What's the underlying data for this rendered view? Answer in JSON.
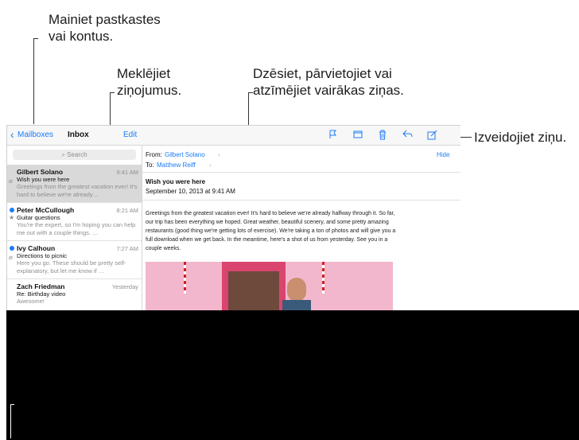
{
  "callouts": {
    "mailboxes": [
      "Mainiet pastkastes",
      "vai kontus."
    ],
    "search": [
      "Meklējiet",
      "ziņojumus."
    ],
    "actions": [
      "Dzēsiet, pārvietojiet vai",
      "atzīmējiet vairākas ziņas."
    ],
    "compose": "Izveidojiet ziņu."
  },
  "toolbar": {
    "back_label": "Mailboxes",
    "title": "Inbox",
    "edit_label": "Edit",
    "icons": [
      "flag-icon",
      "folder-icon",
      "trash-icon",
      "reply-icon",
      "compose-icon"
    ]
  },
  "search": {
    "placeholder": "Search"
  },
  "messages": [
    {
      "sender": "Gilbert Solano",
      "time": "9:41 AM",
      "subject": "Wish you were here",
      "preview": "Greetings from the greatest vacation ever! It's hard to believe we're already…",
      "selected": true,
      "unread": false,
      "attachment": true,
      "flagged": false
    },
    {
      "sender": "Peter McCullough",
      "time": "8:21 AM",
      "subject": "Guitar questions",
      "preview": "You're the expert, so I'm hoping you can help me out with a couple things. …",
      "selected": false,
      "unread": true,
      "attachment": false,
      "flagged": true
    },
    {
      "sender": "Ivy Calhoun",
      "time": "7:27 AM",
      "subject": "Directions to picnic",
      "preview": "Here you go. These should be pretty self-explanatory, but let me know if …",
      "selected": false,
      "unread": true,
      "attachment": true,
      "flagged": false
    },
    {
      "sender": "Zach Friedman",
      "time": "Yesterday",
      "subject": "Re: Birthday video",
      "preview": "Awesome!",
      "selected": false,
      "unread": false,
      "attachment": false,
      "flagged": false
    }
  ],
  "detail": {
    "from_label": "From:",
    "from_name": "Gilbert Solano",
    "to_label": "To:",
    "to_name": "Matthew Reiff",
    "hide_label": "Hide",
    "subject": "Wish you were here",
    "date": "September 10, 2013 at 9:41 AM",
    "body": [
      "Greetings from the greatest vacation ever! It's hard to believe we're already halfway through it. So far,",
      "our trip has been everything we hoped. Great weather, beautiful scenery, and some pretty amazing",
      "restaurants (good thing we're getting lots of exercise). We're taking a ton of photos and will give you a",
      "full download when we get back. In the meantime, here's a shot of us from yesterday. See you in a",
      "couple weeks."
    ]
  },
  "colors": {
    "accent": "#1a7cf7",
    "unread_dot": "#1a7cf7",
    "selected_row": "#d9d9d9",
    "background_overlay": "#000000"
  }
}
